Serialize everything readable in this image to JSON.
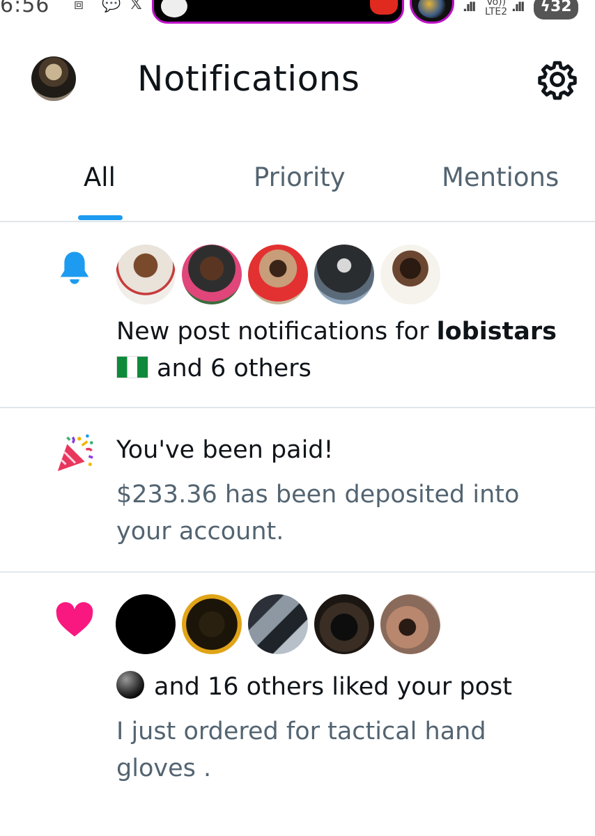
{
  "status_bar": {
    "time": "6:56",
    "network": "LTE2",
    "volte": "Vo))",
    "battery": "32"
  },
  "header": {
    "title": "Notifications"
  },
  "tabs": [
    {
      "label": "All",
      "active": true
    },
    {
      "label": "Priority",
      "active": false
    },
    {
      "label": "Mentions",
      "active": false
    }
  ],
  "notifications": [
    {
      "type": "new-posts",
      "icon": "bell-icon",
      "icon_color": "#1d9bf0",
      "text_prefix": "New post notifications for ",
      "user": "lobistars",
      "text_suffix": "and 6 others"
    },
    {
      "type": "payment",
      "icon": "party-popper-icon",
      "title": "You've been paid!",
      "detail": "$233.36 has been deposited into your account."
    },
    {
      "type": "likes",
      "icon": "heart-icon",
      "icon_color": "#f91880",
      "title": "and 16 others liked your post",
      "post_text": "I just ordered for tactical hand gloves ."
    }
  ],
  "colors": {
    "accent": "#1d9bf0",
    "secondary_text": "#536471",
    "divider": "#e1e6ea"
  }
}
